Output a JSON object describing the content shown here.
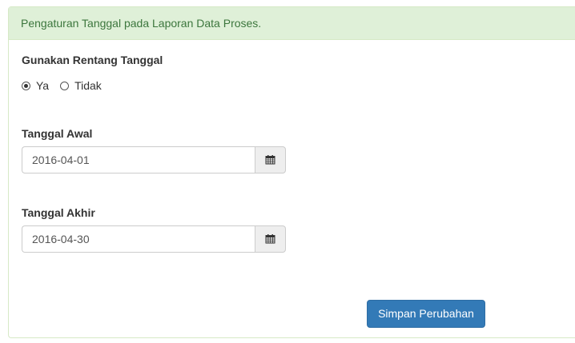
{
  "panel": {
    "heading": "Pengaturan Tanggal pada Laporan Data Proses."
  },
  "range": {
    "label": "Gunakan Rentang Tanggal",
    "options": [
      {
        "label": "Ya",
        "checked": true
      },
      {
        "label": "Tidak",
        "checked": false
      }
    ]
  },
  "start_date": {
    "label": "Tanggal Awal",
    "value": "2016-04-01",
    "icon": "calendar-icon"
  },
  "end_date": {
    "label": "Tanggal Akhir",
    "value": "2016-04-30",
    "icon": "calendar-icon"
  },
  "actions": {
    "save_label": "Simpan Perubahan"
  },
  "colors": {
    "heading_bg": "#dff0d8",
    "heading_text": "#3c763d",
    "primary": "#337ab7"
  }
}
